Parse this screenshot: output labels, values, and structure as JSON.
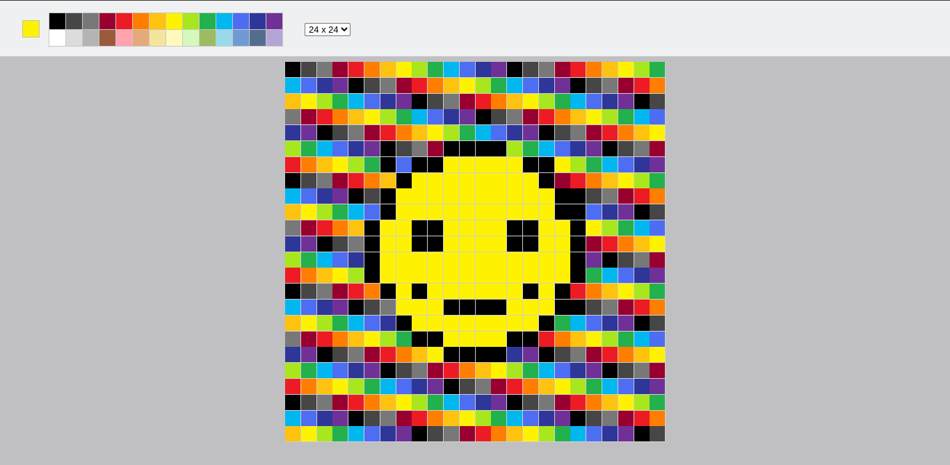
{
  "current_color": "#fff200",
  "palette": [
    [
      "#000000",
      "#464646",
      "#787878",
      "#990030",
      "#ed1c24",
      "#ff7e00",
      "#ffc20e",
      "#fff200",
      "#a8e61d",
      "#22b14c",
      "#00b7ef",
      "#4d6df3",
      "#2f3699",
      "#6f3198"
    ],
    [
      "#ffffff",
      "#dcdcdc",
      "#b4b4b4",
      "#9c5a3c",
      "#ffa3b1",
      "#e5aa7a",
      "#f5e49c",
      "#fff9bd",
      "#d3f9bc",
      "#9dbb61",
      "#99d9ea",
      "#709ad1",
      "#546d8e",
      "#b5a5d5"
    ]
  ],
  "size_select": {
    "selected": "24 x 24",
    "options": [
      "24 x 24"
    ]
  },
  "grid": {
    "cols": 24,
    "rows": 24,
    "palette_order": [
      "#000000",
      "#464646",
      "#787878",
      "#990030",
      "#ed1c24",
      "#ff7e00",
      "#ffc20e",
      "#fff200",
      "#a8e61d",
      "#22b14c",
      "#00b7ef",
      "#4d6df3",
      "#2f3699",
      "#6f3198"
    ],
    "smiley_yellow": [
      [
        6,
        10
      ],
      [
        6,
        11
      ],
      [
        6,
        12
      ],
      [
        6,
        13
      ],
      [
        6,
        14
      ],
      [
        7,
        8
      ],
      [
        7,
        9
      ],
      [
        7,
        10
      ],
      [
        7,
        11
      ],
      [
        7,
        12
      ],
      [
        7,
        13
      ],
      [
        7,
        14
      ],
      [
        7,
        15
      ],
      [
        8,
        7
      ],
      [
        8,
        8
      ],
      [
        8,
        9
      ],
      [
        8,
        10
      ],
      [
        8,
        11
      ],
      [
        8,
        12
      ],
      [
        8,
        13
      ],
      [
        8,
        14
      ],
      [
        8,
        15
      ],
      [
        8,
        16
      ],
      [
        9,
        7
      ],
      [
        9,
        8
      ],
      [
        9,
        9
      ],
      [
        9,
        10
      ],
      [
        9,
        11
      ],
      [
        9,
        12
      ],
      [
        9,
        13
      ],
      [
        9,
        14
      ],
      [
        9,
        15
      ],
      [
        9,
        16
      ],
      [
        10,
        6
      ],
      [
        10,
        7
      ],
      [
        10,
        10
      ],
      [
        10,
        11
      ],
      [
        10,
        12
      ],
      [
        10,
        13
      ],
      [
        10,
        16
      ],
      [
        10,
        17
      ],
      [
        11,
        6
      ],
      [
        11,
        7
      ],
      [
        11,
        10
      ],
      [
        11,
        11
      ],
      [
        11,
        12
      ],
      [
        11,
        13
      ],
      [
        11,
        16
      ],
      [
        11,
        17
      ],
      [
        12,
        6
      ],
      [
        12,
        7
      ],
      [
        12,
        8
      ],
      [
        12,
        9
      ],
      [
        12,
        10
      ],
      [
        12,
        11
      ],
      [
        12,
        12
      ],
      [
        12,
        13
      ],
      [
        12,
        14
      ],
      [
        12,
        15
      ],
      [
        12,
        16
      ],
      [
        12,
        17
      ],
      [
        13,
        6
      ],
      [
        13,
        7
      ],
      [
        13,
        8
      ],
      [
        13,
        9
      ],
      [
        13,
        10
      ],
      [
        13,
        11
      ],
      [
        13,
        12
      ],
      [
        13,
        13
      ],
      [
        13,
        14
      ],
      [
        13,
        15
      ],
      [
        13,
        16
      ],
      [
        13,
        17
      ],
      [
        14,
        7
      ],
      [
        14,
        9
      ],
      [
        14,
        10
      ],
      [
        14,
        11
      ],
      [
        14,
        12
      ],
      [
        14,
        13
      ],
      [
        14,
        14
      ],
      [
        14,
        16
      ],
      [
        15,
        7
      ],
      [
        15,
        8
      ],
      [
        15,
        9
      ],
      [
        15,
        14
      ],
      [
        15,
        15
      ],
      [
        15,
        16
      ],
      [
        16,
        8
      ],
      [
        16,
        9
      ],
      [
        16,
        10
      ],
      [
        16,
        11
      ],
      [
        16,
        12
      ],
      [
        16,
        13
      ],
      [
        16,
        14
      ],
      [
        16,
        15
      ],
      [
        17,
        10
      ],
      [
        17,
        11
      ],
      [
        17,
        12
      ],
      [
        17,
        13
      ]
    ],
    "smiley_black": [
      [
        5,
        10
      ],
      [
        5,
        11
      ],
      [
        5,
        12
      ],
      [
        5,
        13
      ],
      [
        6,
        6
      ],
      [
        6,
        8
      ],
      [
        6,
        9
      ],
      [
        6,
        15
      ],
      [
        6,
        16
      ],
      [
        7,
        7
      ],
      [
        7,
        16
      ],
      [
        8,
        6
      ],
      [
        8,
        17
      ],
      [
        9,
        6
      ],
      [
        9,
        17
      ],
      [
        9,
        18
      ],
      [
        10,
        5
      ],
      [
        10,
        8
      ],
      [
        10,
        9
      ],
      [
        10,
        14
      ],
      [
        10,
        15
      ],
      [
        10,
        18
      ],
      [
        11,
        5
      ],
      [
        11,
        8
      ],
      [
        11,
        9
      ],
      [
        11,
        14
      ],
      [
        11,
        15
      ],
      [
        11,
        18
      ],
      [
        12,
        5
      ],
      [
        12,
        18
      ],
      [
        13,
        5
      ],
      [
        13,
        18
      ],
      [
        14,
        6
      ],
      [
        14,
        8
      ],
      [
        14,
        15
      ],
      [
        14,
        17
      ],
      [
        15,
        10
      ],
      [
        15,
        11
      ],
      [
        15,
        12
      ],
      [
        15,
        13
      ],
      [
        15,
        17
      ],
      [
        16,
        7
      ],
      [
        16,
        16
      ],
      [
        17,
        8
      ],
      [
        17,
        9
      ],
      [
        17,
        14
      ],
      [
        17,
        15
      ],
      [
        18,
        10
      ],
      [
        18,
        11
      ],
      [
        18,
        12
      ],
      [
        18,
        13
      ]
    ]
  }
}
